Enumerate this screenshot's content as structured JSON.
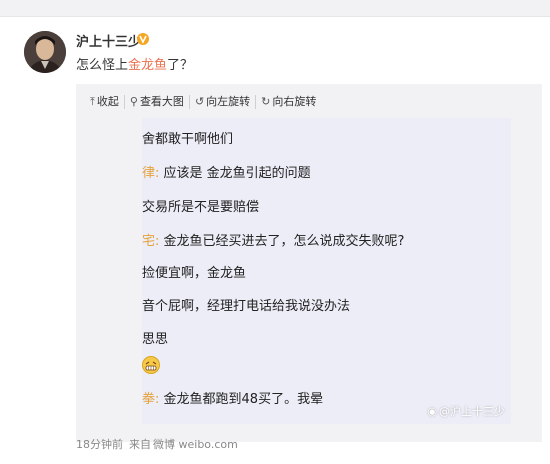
{
  "post": {
    "username": "沪上十三少",
    "text_before": "怎么怪上",
    "text_highlight": "金龙鱼",
    "text_after": "了？"
  },
  "toolbar": {
    "collapse": "收起",
    "view_large": "查看大图",
    "rotate_left": "向左旋转",
    "rotate_right": "向右旋转"
  },
  "chat": {
    "lines": [
      {
        "speaker": "",
        "text": "舍都敢干啊他们"
      },
      {
        "speaker": "律:",
        "text": " 应该是 金龙鱼引起的问题"
      },
      {
        "speaker": "",
        "text": "交易所是不是要赔偿"
      },
      {
        "speaker": "宅:",
        "text": " 金龙鱼已经买进去了，怎么说成交失败呢?"
      },
      {
        "speaker": "",
        "text": "捡便宜啊，金龙鱼"
      },
      {
        "speaker": "",
        "text": "音个屁啊，经理打电话给我说没办法"
      },
      {
        "speaker": "",
        "text": "思思"
      },
      {
        "speaker": "拳:",
        "text": " 金龙鱼都跑到48买了。我晕"
      }
    ],
    "watermark": "@沪上十三少"
  },
  "footer": {
    "time": "18分钟前",
    "source_prefix": "来自",
    "source": "微博 weibo.com"
  },
  "colors": {
    "highlight": "#eb7350",
    "speaker": "#e6a23c",
    "vip": "#f5a623"
  }
}
